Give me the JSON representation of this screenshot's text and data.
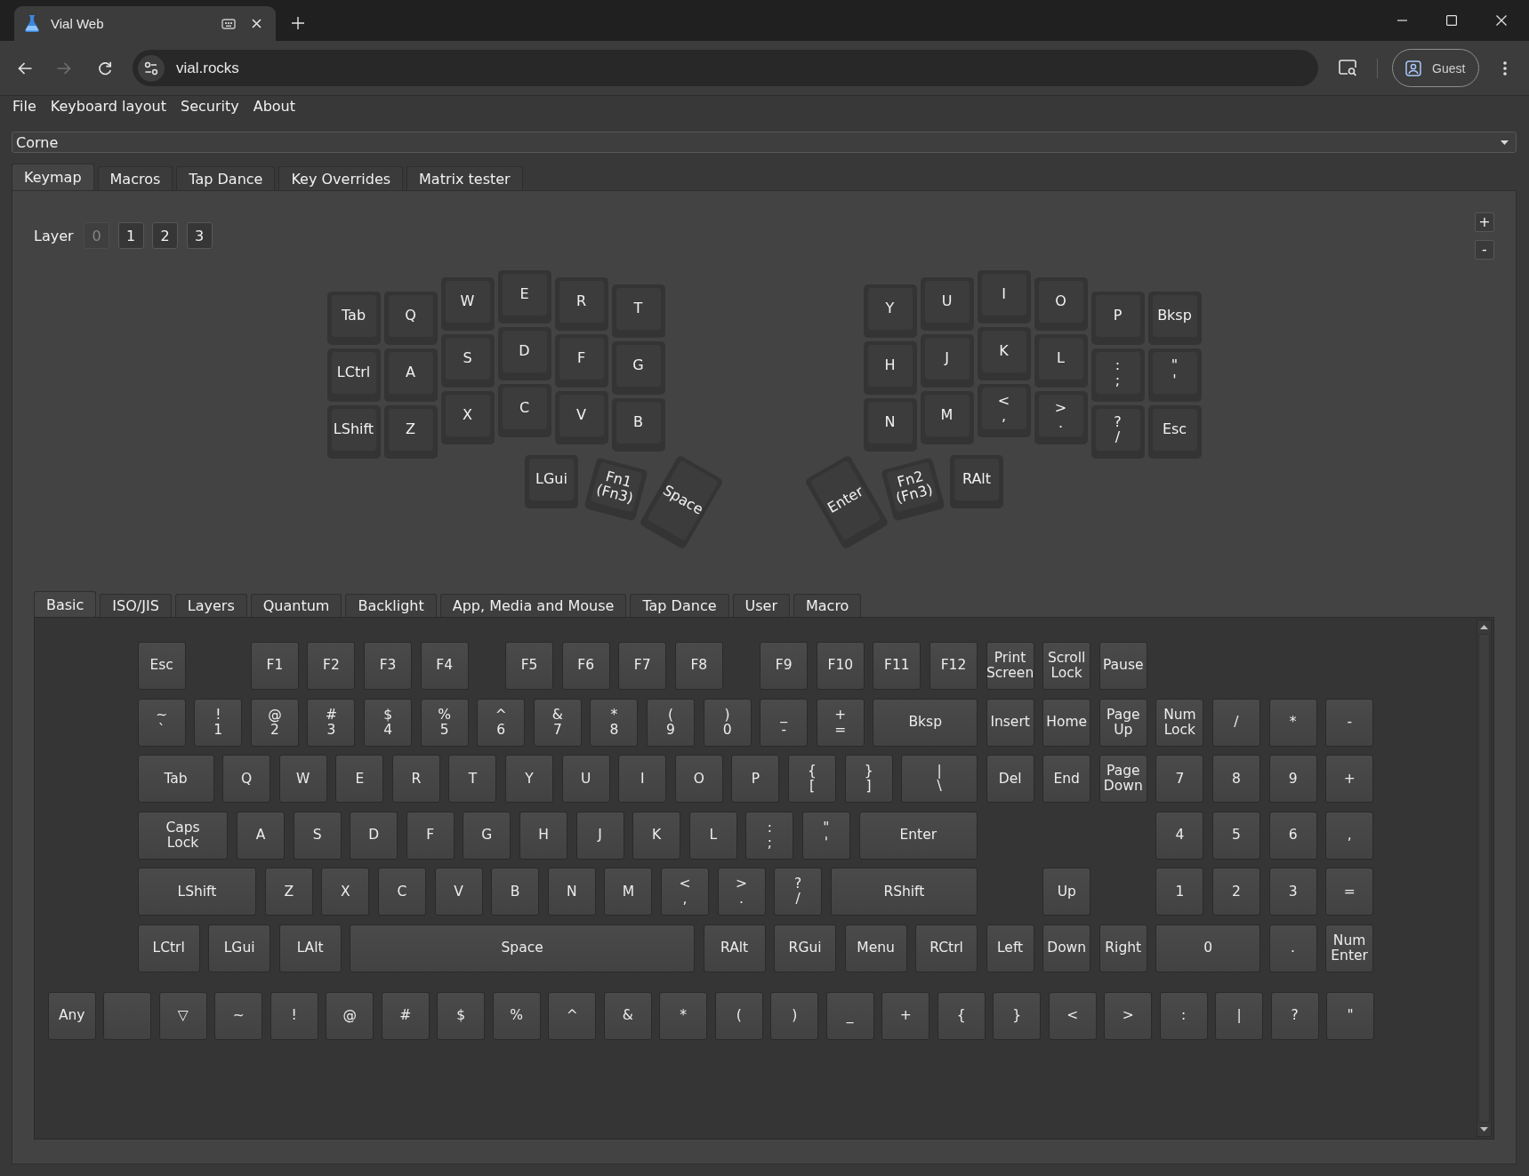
{
  "browser": {
    "tab": {
      "title": "Vial Web"
    },
    "nav": [
      {
        "kind": "back",
        "disabled": false
      },
      {
        "kind": "forward",
        "disabled": true
      },
      {
        "kind": "reload",
        "disabled": false
      }
    ],
    "address": "vial.rocks",
    "profile": "Guest"
  },
  "menu": [
    "File",
    "Keyboard layout",
    "Security",
    "About"
  ],
  "keyboard_select": {
    "value": "Corne"
  },
  "tabs": [
    {
      "label": "Keymap",
      "selected": true
    },
    {
      "label": "Macros",
      "selected": false
    },
    {
      "label": "Tap Dance",
      "selected": false
    },
    {
      "label": "Key Overrides",
      "selected": false
    },
    {
      "label": "Matrix tester",
      "selected": false
    }
  ],
  "layers": {
    "label": "Layer",
    "items": [
      {
        "label": "0",
        "selected": true
      },
      {
        "label": "1",
        "selected": false
      },
      {
        "label": "2",
        "selected": false
      },
      {
        "label": "3",
        "selected": false
      }
    ]
  },
  "size_buttons": [
    "+",
    "-"
  ],
  "keymap": {
    "left_rows": [
      [
        "Tab",
        "Q",
        "W",
        "E",
        "R",
        "T"
      ],
      [
        "LCtrl",
        "A",
        "S",
        "D",
        "F",
        "G"
      ],
      [
        "LShift",
        "Z",
        "X",
        "C",
        "V",
        "B"
      ]
    ],
    "left_thumbs": [
      "LGui",
      "Fn1\n(Fn3)",
      "Space"
    ],
    "right_rows": [
      [
        "Y",
        "U",
        "I",
        "O",
        "P",
        "Bksp"
      ],
      [
        "H",
        "J",
        "K",
        "L",
        ":\n;",
        "\"\n'"
      ],
      [
        "N",
        "M",
        "<\n,",
        ">\n.",
        "?\n/",
        "Esc"
      ]
    ],
    "right_thumbs": [
      "Enter",
      "Fn2\n(Fn3)",
      "RAlt"
    ]
  },
  "keycode_tabs": [
    {
      "label": "Basic",
      "selected": true
    },
    {
      "label": "ISO/JIS",
      "selected": false
    },
    {
      "label": "Layers",
      "selected": false
    },
    {
      "label": "Quantum",
      "selected": false
    },
    {
      "label": "Backlight",
      "selected": false
    },
    {
      "label": "App, Media and Mouse",
      "selected": false
    },
    {
      "label": "Tap Dance",
      "selected": false
    },
    {
      "label": "User",
      "selected": false
    },
    {
      "label": "Macro",
      "selected": false
    }
  ],
  "keycodes": {
    "rows": [
      {
        "keys": [
          "Esc",
          "F1",
          "F2",
          "F3",
          "F4",
          "F5",
          "F6",
          "F7",
          "F8",
          "F9",
          "F10",
          "F11",
          "F12",
          "Print\nScreen",
          "Scroll\nLock",
          "Pause"
        ]
      },
      {
        "keys": [
          "~\n`",
          "!\n1",
          "@\n2",
          "#\n3",
          "$\n4",
          "%\n5",
          "^\n6",
          "&\n7",
          "*\n8",
          "(\n9",
          ")\n0",
          "_\n-",
          "+\n=",
          "Bksp",
          "Insert",
          "Home",
          "Page\nUp",
          "Num\nLock",
          "/",
          "*",
          "-"
        ]
      },
      {
        "keys": [
          "Tab",
          "Q",
          "W",
          "E",
          "R",
          "T",
          "Y",
          "U",
          "I",
          "O",
          "P",
          "{\n[",
          "}\n]",
          "|\n\\",
          "Del",
          "End",
          "Page\nDown",
          "7",
          "8",
          "9",
          "+"
        ]
      },
      {
        "keys": [
          "Caps\nLock",
          "A",
          "S",
          "D",
          "F",
          "G",
          "H",
          "J",
          "K",
          "L",
          ":\n;",
          "\"\n'",
          "Enter",
          "4",
          "5",
          "6",
          ","
        ]
      },
      {
        "keys": [
          "LShift",
          "Z",
          "X",
          "C",
          "V",
          "B",
          "N",
          "M",
          "<\n,",
          ">\n.",
          "?\n/",
          "RShift",
          "Up",
          "1",
          "2",
          "3",
          "="
        ]
      },
      {
        "keys": [
          "LCtrl",
          "LGui",
          "LAlt",
          "Space",
          "RAlt",
          "RGui",
          "Menu",
          "RCtrl",
          "Left",
          "Down",
          "Right",
          "0",
          ".",
          "Num\nEnter"
        ]
      }
    ],
    "special": [
      {
        "kind": "label",
        "label": "Any"
      },
      {
        "kind": "empty"
      },
      {
        "kind": "label",
        "label": "▽"
      },
      {
        "kind": "label",
        "label": "~"
      },
      {
        "kind": "label",
        "label": "!"
      },
      {
        "kind": "label",
        "label": "@"
      },
      {
        "kind": "label",
        "label": "#"
      },
      {
        "kind": "label",
        "label": "$"
      },
      {
        "kind": "label",
        "label": "%"
      },
      {
        "kind": "label",
        "label": "^"
      },
      {
        "kind": "label",
        "label": "&"
      },
      {
        "kind": "label",
        "label": "*"
      },
      {
        "kind": "label",
        "label": "("
      },
      {
        "kind": "label",
        "label": ")"
      },
      {
        "kind": "label",
        "label": "_"
      },
      {
        "kind": "label",
        "label": "+"
      },
      {
        "kind": "label",
        "label": "{"
      },
      {
        "kind": "label",
        "label": "}"
      },
      {
        "kind": "label",
        "label": "<"
      },
      {
        "kind": "label",
        "label": ">"
      },
      {
        "kind": "label",
        "label": ":"
      },
      {
        "kind": "label",
        "label": "|"
      },
      {
        "kind": "label",
        "label": "?"
      },
      {
        "kind": "label",
        "label": "\""
      }
    ]
  }
}
